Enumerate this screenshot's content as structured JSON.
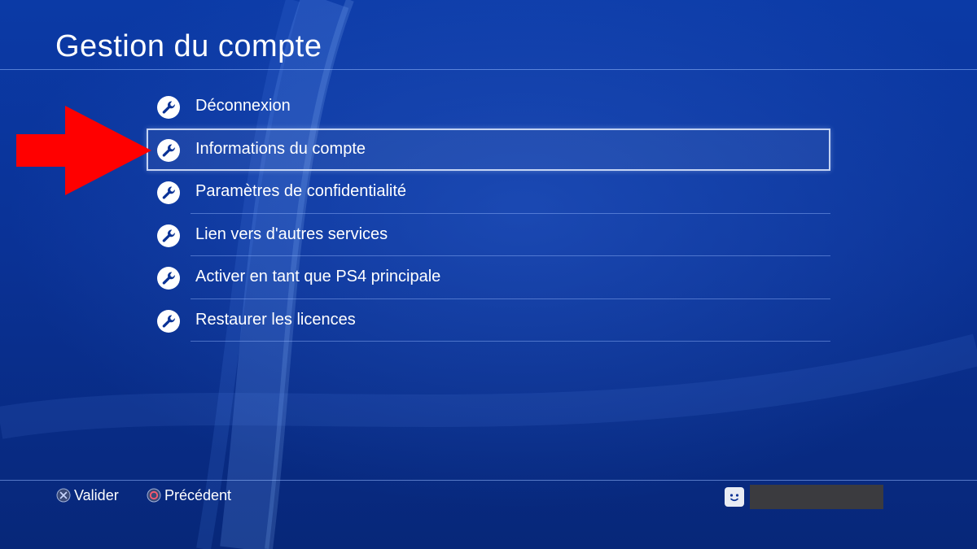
{
  "header": {
    "title": "Gestion du compte"
  },
  "menu": {
    "selected_index": 1,
    "items": [
      {
        "label": "Déconnexion",
        "icon": "wrench-icon"
      },
      {
        "label": "Informations du compte",
        "icon": "wrench-icon"
      },
      {
        "label": "Paramètres de confidentialité",
        "icon": "wrench-icon"
      },
      {
        "label": "Lien vers d'autres services",
        "icon": "wrench-icon"
      },
      {
        "label": "Activer en tant que PS4 principale",
        "icon": "wrench-icon"
      },
      {
        "label": "Restaurer les licences",
        "icon": "wrench-icon"
      }
    ]
  },
  "footer": {
    "confirm": {
      "icon": "cross-button-icon",
      "label": "Valider"
    },
    "back": {
      "icon": "circle-button-icon",
      "label": "Précédent"
    }
  },
  "user": {
    "avatar_icon": "smiley-avatar-icon",
    "name_redacted": true
  },
  "annotation": {
    "icon": "arrow-right-icon",
    "color": "#ff0000",
    "points_to_index": 1
  },
  "colors": {
    "background": "#0a3296",
    "text": "#ffffff",
    "selection_border": "#e1ebff",
    "redaction": "#3b3b3f"
  }
}
